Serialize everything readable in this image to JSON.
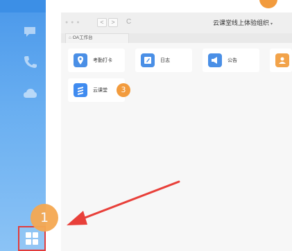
{
  "window": {
    "title": "云课堂线上体验组织",
    "tab_label": "OA工作台",
    "nav_back": "<",
    "nav_forward": ">",
    "refresh_glyph": "C"
  },
  "apps": [
    {
      "label": "考勤打卡",
      "icon": "location-pin-icon",
      "color": "#4a8fe6"
    },
    {
      "label": "日志",
      "icon": "notebook-icon",
      "color": "#4a8fe6"
    },
    {
      "label": "公告",
      "icon": "megaphone-icon",
      "color": "#4a8fe6"
    },
    {
      "label": "",
      "icon": "contact-card-icon",
      "color": "#f2a34a"
    },
    {
      "label": "云课堂",
      "icon": "cloud-classroom-icon",
      "color": "#3f8bf0"
    }
  ],
  "steps": {
    "step_1": "1",
    "step_3": "3"
  },
  "sidebar": {
    "icons": [
      "phone-icon",
      "cloud-icon"
    ],
    "workbench_icon": "workbench-grid-icon"
  },
  "colors": {
    "sidebar": "#5aa3ee",
    "highlight": "#e23b3b",
    "badge": "#f29b3d",
    "arrow": "#e8403a"
  }
}
